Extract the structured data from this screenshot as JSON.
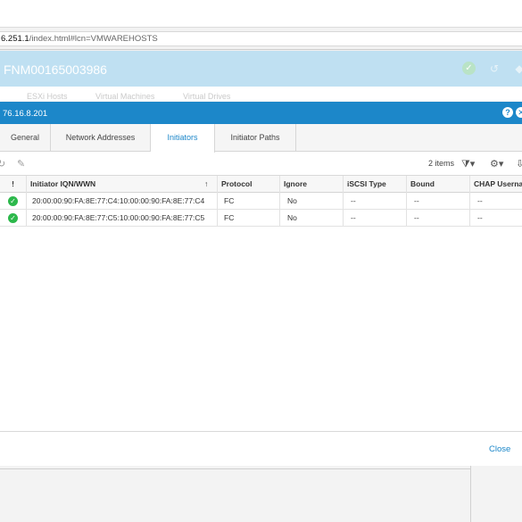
{
  "browser": {
    "url_host": "6.251.1",
    "url_path": "/index.html#lcn=VMWAREHOSTS"
  },
  "app": {
    "title": "FNM00165003986",
    "subtabs": [
      "ESXi Hosts",
      "Virtual Machines",
      "Virtual Drives"
    ]
  },
  "modal": {
    "title": "76.16.8.201",
    "help_label": "?",
    "close_label": "✕",
    "tabs": [
      "General",
      "Network Addresses",
      "Initiators",
      "Initiator Paths"
    ],
    "active_tab": "Initiators",
    "toolbar": {
      "items_count": "2 items"
    },
    "table": {
      "headers": [
        "!",
        "Initiator IQN/WWN",
        "Protocol",
        "Ignore",
        "iSCSI Type",
        "Bound",
        "CHAP Username"
      ],
      "sort_indicator": "↑",
      "rows": [
        {
          "status": "ok",
          "iqn": "20:00:00:90:FA:8E:77:C4:10:00:00:90:FA:8E:77:C4",
          "protocol": "FC",
          "ignore": "No",
          "iscsi_type": "--",
          "bound": "--",
          "chap": "--"
        },
        {
          "status": "ok",
          "iqn": "20:00:00:90:FA:8E:77:C5:10:00:00:90:FA:8E:77:C5",
          "protocol": "FC",
          "ignore": "No",
          "iscsi_type": "--",
          "bound": "--",
          "chap": "--"
        }
      ]
    },
    "footer": {
      "close_button": "Close"
    }
  },
  "colors": {
    "accent": "#1c87c9",
    "header_faded": "#bfe0f2",
    "status_ok": "#2cb84b"
  }
}
